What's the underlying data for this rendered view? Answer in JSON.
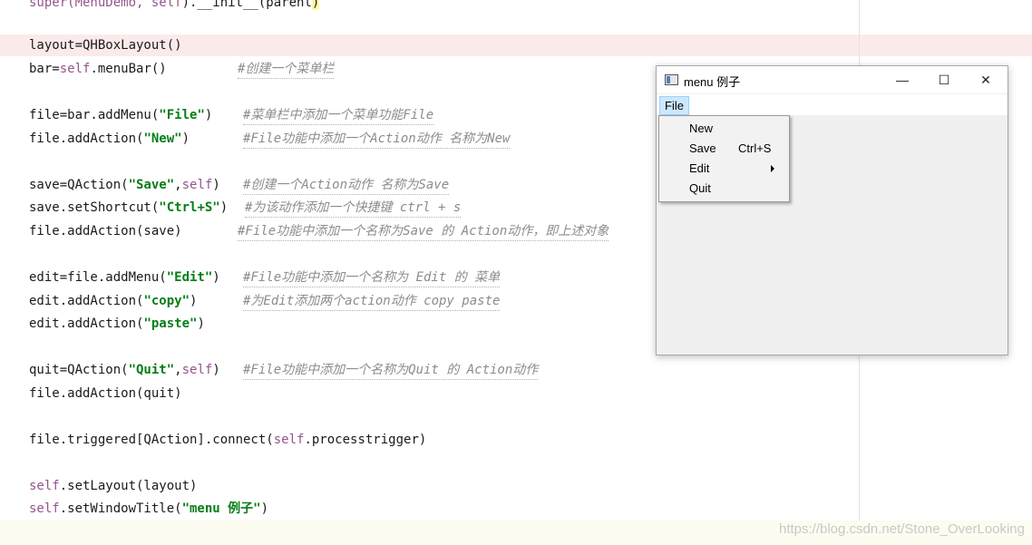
{
  "editor": {
    "lines": [
      {
        "pre": "super(MenuDemo, ",
        "kw": "self",
        "post": ").__init__(parent",
        "brace": ")"
      },
      {
        "code": "layout=QHBoxLayout()"
      },
      {
        "pre": "bar=",
        "kw": "self",
        "post": ".menuBar()",
        "comment": "#创建一个菜单栏"
      },
      {
        "pre": "file=bar.addMenu(",
        "str": "\"File\"",
        "post": ")",
        "comment": "#菜单栏中添加一个菜单功能File"
      },
      {
        "pre": "file.addAction(",
        "str": "\"New\"",
        "post": ")",
        "comment": "#File功能中添加一个Action动作 名称为New"
      },
      {
        "pre": "save=QAction(",
        "str": "\"Save\"",
        "mid": ",",
        "kw": "self",
        "post": ")",
        "comment": "#创建一个Action动作 名称为Save"
      },
      {
        "pre": "save.setShortcut(",
        "str": "\"Ctrl+S\"",
        "post": ")",
        "comment": "#为该动作添加一个快捷键 ctrl + s"
      },
      {
        "code": "file.addAction(save)",
        "comment": "#File功能中添加一个名称为Save 的 Action动作，即上述对象"
      },
      {
        "pre": "edit=file.addMenu(",
        "str": "\"Edit\"",
        "post": ")",
        "comment": "#File功能中添加一个名称为 Edit 的 菜单"
      },
      {
        "pre": "edit.addAction(",
        "str": "\"copy\"",
        "post": ")",
        "comment": "#为Edit添加两个action动作 copy paste"
      },
      {
        "pre": "edit.addAction(",
        "str": "\"paste\"",
        "post": ")"
      },
      {
        "pre": "quit=QAction(",
        "str": "\"Quit\"",
        "mid": ",",
        "kw": "self",
        "post": ")",
        "comment": "#File功能中添加一个名称为Quit 的 Action动作"
      },
      {
        "code": "file.addAction(quit)"
      },
      {
        "pre": "file.triggered[QAction].connect(",
        "kw": "self",
        "post": ".processtrigger)"
      },
      {
        "kw": "self",
        "post": ".setLayout(layout)"
      },
      {
        "kw": "self",
        "post": ".setWindowTitle(",
        "str": "\"menu 例子\"",
        "post2": ")"
      }
    ]
  },
  "watermark": "https://blog.csdn.net/Stone_OverLooking",
  "window": {
    "title": "menu 例子",
    "minimize_glyph": "—",
    "maximize_glyph": "☐",
    "close_glyph": "✕",
    "menubar": {
      "file_label": "File"
    },
    "file_menu": {
      "items": [
        {
          "label": "New",
          "shortcut": ""
        },
        {
          "label": "Save",
          "shortcut": "Ctrl+S"
        },
        {
          "label": "Edit",
          "shortcut": "",
          "submenu": true
        },
        {
          "label": "Quit",
          "shortcut": ""
        }
      ]
    }
  },
  "colors": {
    "keyword": "#94558d",
    "string": "#067d17",
    "comment": "#8c8c8c",
    "menu_highlight": "#cce8ff"
  }
}
